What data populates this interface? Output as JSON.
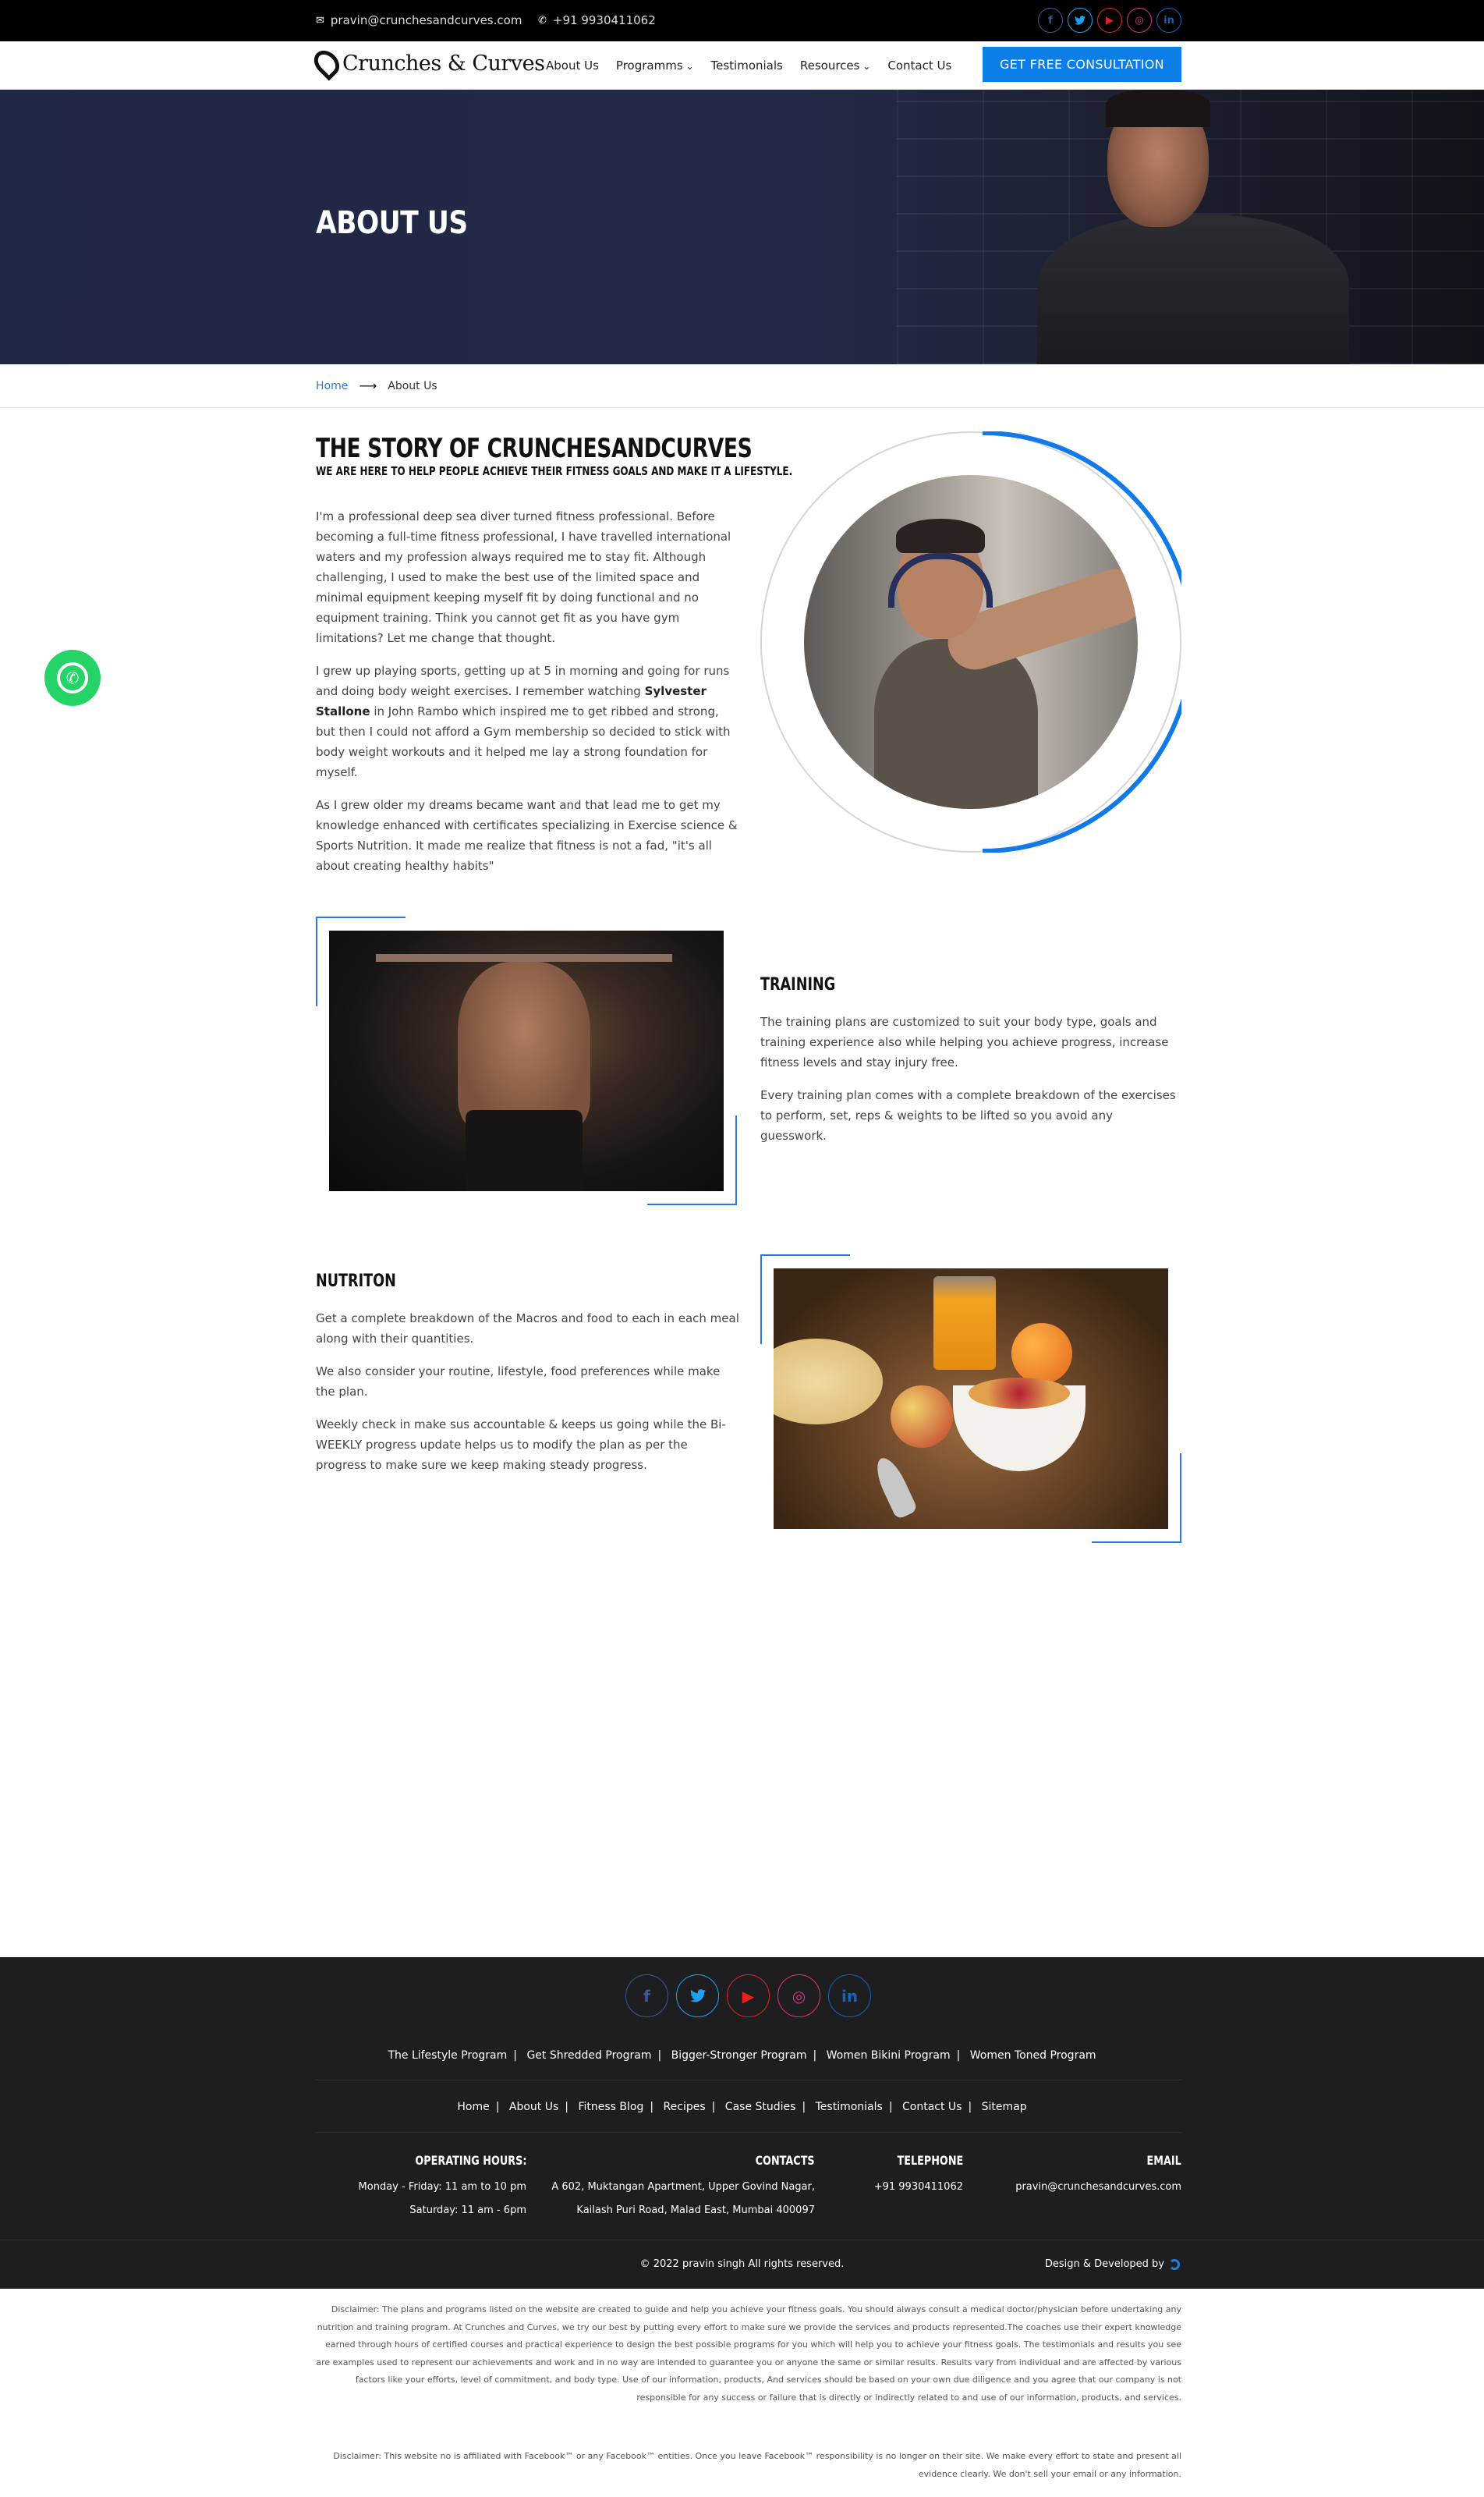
{
  "topbar": {
    "email": "pravin@crunchesandcurves.com",
    "phone": "+91 9930411062",
    "social": [
      {
        "name": "facebook",
        "glyph": "f",
        "color": "#3b5998"
      },
      {
        "name": "twitter",
        "glyph": "t",
        "color": "#1da1f2"
      },
      {
        "name": "youtube",
        "glyph": "▶",
        "color": "#e02424"
      },
      {
        "name": "instagram",
        "glyph": "◎",
        "color": "#d63384"
      },
      {
        "name": "linkedin",
        "glyph": "in",
        "color": "#0a66c2"
      }
    ]
  },
  "nav": {
    "logo": "Crunches & Curves",
    "items": [
      "About Us",
      "Programms",
      "Testimonials",
      "Resources",
      "Contact Us"
    ],
    "cta": "GET FREE CONSULTATION"
  },
  "hero": {
    "title": "ABOUT US"
  },
  "breadcrumb": {
    "home": "Home",
    "current": "About Us"
  },
  "story": {
    "title": "THE STORY OF CRUNCHESANDCURVES",
    "subtitle": "WE ARE HERE TO HELP PEOPLE ACHIEVE THEIR FITNESS GOALS AND MAKE IT A LIFESTYLE.",
    "p1": "I'm a professional deep sea diver turned fitness professional. Before becoming a full-time fitness professional, I have travelled international waters and my profession always required me to stay fit. Although challenging, I used to make the best use of the limited space and minimal equipment keeping myself fit by doing functional and no equipment training. Think you cannot get fit as you have gym limitations? Let me change that thought.",
    "p2a": "I grew up playing sports, getting up at 5 in morning and going for runs and doing body weight exercises. I remember watching ",
    "p2b": "Sylvester Stallone",
    "p2c": " in John Rambo which inspired me to get ribbed and strong, but then I could not afford a Gym membership so decided to stick with body weight workouts and it helped me lay a strong foundation for myself.",
    "p3": "As I grew older my dreams became want and that lead me to get my knowledge enhanced with certificates specializing in Exercise science & Sports Nutrition. It made me realize that fitness is not a fad, \"it's all about creating healthy habits\""
  },
  "training": {
    "title": "TRAINING",
    "p1": "The training plans are customized to suit your body type, goals and training experience also while helping you achieve progress, increase fitness levels and stay injury free.",
    "p2": "Every training plan comes with a complete breakdown of the exercises to perform, set, reps & weights to be lifted so you avoid any guesswork."
  },
  "nutrition": {
    "title": "NUTRITON",
    "p1": "Get a complete breakdown of the Macros and food to each in each meal along with their quantities.",
    "p2": "We also consider your routine, lifestyle, food preferences while make the plan.",
    "p3": "Weekly check in make sus accountable & keeps us going while the Bi-WEEKLY progress update helps us to modify the plan as per the progress to make sure we keep making steady progress."
  },
  "footer": {
    "programs": [
      "The Lifestyle Program",
      "Get Shredded Program",
      "Bigger-Stronger Program",
      "Women Bikini Program",
      "Women Toned Program"
    ],
    "links": [
      "Home",
      "About Us",
      "Fitness Blog",
      "Recipes",
      "Case Studies",
      "Testimonials",
      "Contact Us",
      "Sitemap"
    ],
    "hours_title": "OPERATING HOURS:",
    "hours1": "Monday - Friday: 11 am to 10 pm",
    "hours2": "Saturday: 11 am - 6pm",
    "contacts_title": "CONTACTS",
    "address1": "A 602, Muktangan Apartment, Upper Govind Nagar,",
    "address2": "Kailash Puri Road, Malad East, Mumbai 400097",
    "tel_title": "TELEPHONE",
    "tel": "+91 9930411062",
    "email_title": "EMAIL",
    "email": "pravin@crunchesandcurves.com",
    "copyright": "© 2022 pravin singh All rights reserved.",
    "developed": "Design & Developed by"
  },
  "disclaimer": {
    "p1": "Disclaimer: The plans and programs listed on the website are created to guide and help you achieve your fitness goals. You should always consult a medical doctor/physician before undertaking any nutrition and training program. At Crunches and Curves, we try our best by putting every effort to make sure we provide the services and products represented.The coaches use their expert knowledge earned through hours of certified courses and practical experience to design the best possible programs for you which will help you to achieve your fitness goals. The testimonials and results you see are examples used to represent our achievements and work and in no way are intended to guarantee you or anyone the same or similar results. Results vary from individual and are affected by various factors like your efforts, level of commitment, and body type. Use of our information, products, And services should be based on your own due diligence and you agree that our company is not responsible for any success or failure that is directly or indirectly related to and use of our information, products, and services.",
    "p2": "Disclaimer: This website no is affiliated with Facebook™ or any Facebook™ entities. Once you leave Facebook™ responsibility is no longer on their site. We make every effort to state and present all evidence clearly. We don't sell your email or any information."
  }
}
